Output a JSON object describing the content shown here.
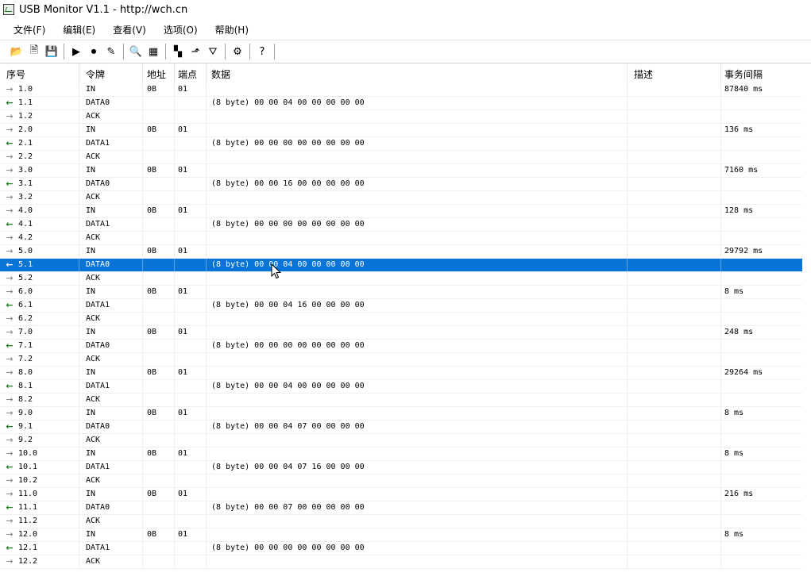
{
  "window": {
    "title": "USB Monitor V1.1 - http://wch.cn",
    "icon": "app-chart-icon"
  },
  "menu": [
    "文件(F)",
    "编辑(E)",
    "查看(V)",
    "选项(O)",
    "帮助(H)"
  ],
  "toolbar": [
    {
      "icon": "open-folder-icon",
      "glyph": "📂"
    },
    {
      "icon": "save-as-icon",
      "glyph": "🗎"
    },
    {
      "icon": "save-icon",
      "glyph": "💾"
    },
    {
      "sep": true
    },
    {
      "icon": "play-icon",
      "glyph": "▶"
    },
    {
      "icon": "record-icon",
      "glyph": "⏺"
    },
    {
      "icon": "edit-check-icon",
      "glyph": "✎"
    },
    {
      "sep": true
    },
    {
      "icon": "find-icon",
      "glyph": "🔍"
    },
    {
      "icon": "table-icon",
      "glyph": "▦"
    },
    {
      "sep": true
    },
    {
      "icon": "color-grid-icon",
      "glyph": "▚"
    },
    {
      "icon": "up-arrow-icon",
      "glyph": "⬏"
    },
    {
      "icon": "filter-icon",
      "glyph": "⛛"
    },
    {
      "sep": true
    },
    {
      "icon": "settings-icon",
      "glyph": "⚙"
    },
    {
      "sep": true
    },
    {
      "icon": "help-icon",
      "glyph": "?"
    },
    {
      "sep": true
    }
  ],
  "columns": {
    "seq": "序号",
    "token": "令牌",
    "addr": "地址",
    "ep": "端点",
    "data": "数据",
    "desc": "描述",
    "interval": "事务间隔"
  },
  "rows": [
    {
      "dir": "out",
      "seq": "1.0",
      "token": "IN",
      "addr": "0B",
      "ep": "01",
      "data": "",
      "desc": "",
      "interval": "87840 ms"
    },
    {
      "dir": "in",
      "seq": "1.1",
      "token": "DATA0",
      "addr": "",
      "ep": "",
      "data": "(8 byte) 00 00 04 00 00 00 00 00",
      "desc": "",
      "interval": ""
    },
    {
      "dir": "out",
      "seq": "1.2",
      "token": "ACK",
      "addr": "",
      "ep": "",
      "data": "",
      "desc": "",
      "interval": ""
    },
    {
      "dir": "out",
      "seq": "2.0",
      "token": "IN",
      "addr": "0B",
      "ep": "01",
      "data": "",
      "desc": "",
      "interval": "136 ms"
    },
    {
      "dir": "in",
      "seq": "2.1",
      "token": "DATA1",
      "addr": "",
      "ep": "",
      "data": "(8 byte) 00 00 00 00 00 00 00 00",
      "desc": "",
      "interval": ""
    },
    {
      "dir": "out",
      "seq": "2.2",
      "token": "ACK",
      "addr": "",
      "ep": "",
      "data": "",
      "desc": "",
      "interval": ""
    },
    {
      "dir": "out",
      "seq": "3.0",
      "token": "IN",
      "addr": "0B",
      "ep": "01",
      "data": "",
      "desc": "",
      "interval": "7160 ms"
    },
    {
      "dir": "in",
      "seq": "3.1",
      "token": "DATA0",
      "addr": "",
      "ep": "",
      "data": "(8 byte) 00 00 16 00 00 00 00 00",
      "desc": "",
      "interval": ""
    },
    {
      "dir": "out",
      "seq": "3.2",
      "token": "ACK",
      "addr": "",
      "ep": "",
      "data": "",
      "desc": "",
      "interval": ""
    },
    {
      "dir": "out",
      "seq": "4.0",
      "token": "IN",
      "addr": "0B",
      "ep": "01",
      "data": "",
      "desc": "",
      "interval": "128 ms"
    },
    {
      "dir": "in",
      "seq": "4.1",
      "token": "DATA1",
      "addr": "",
      "ep": "",
      "data": "(8 byte) 00 00 00 00 00 00 00 00",
      "desc": "",
      "interval": ""
    },
    {
      "dir": "out",
      "seq": "4.2",
      "token": "ACK",
      "addr": "",
      "ep": "",
      "data": "",
      "desc": "",
      "interval": ""
    },
    {
      "dir": "out",
      "seq": "5.0",
      "token": "IN",
      "addr": "0B",
      "ep": "01",
      "data": "",
      "desc": "",
      "interval": "29792 ms"
    },
    {
      "dir": "in",
      "seq": "5.1",
      "token": "DATA0",
      "addr": "",
      "ep": "",
      "data": "(8 byte) 00 00 04 00 00 00 00 00",
      "desc": "",
      "interval": "",
      "selected": true
    },
    {
      "dir": "out",
      "seq": "5.2",
      "token": "ACK",
      "addr": "",
      "ep": "",
      "data": "",
      "desc": "",
      "interval": ""
    },
    {
      "dir": "out",
      "seq": "6.0",
      "token": "IN",
      "addr": "0B",
      "ep": "01",
      "data": "",
      "desc": "",
      "interval": "8 ms"
    },
    {
      "dir": "in",
      "seq": "6.1",
      "token": "DATA1",
      "addr": "",
      "ep": "",
      "data": "(8 byte) 00 00 04 16 00 00 00 00",
      "desc": "",
      "interval": ""
    },
    {
      "dir": "out",
      "seq": "6.2",
      "token": "ACK",
      "addr": "",
      "ep": "",
      "data": "",
      "desc": "",
      "interval": ""
    },
    {
      "dir": "out",
      "seq": "7.0",
      "token": "IN",
      "addr": "0B",
      "ep": "01",
      "data": "",
      "desc": "",
      "interval": "248 ms"
    },
    {
      "dir": "in",
      "seq": "7.1",
      "token": "DATA0",
      "addr": "",
      "ep": "",
      "data": "(8 byte) 00 00 00 00 00 00 00 00",
      "desc": "",
      "interval": ""
    },
    {
      "dir": "out",
      "seq": "7.2",
      "token": "ACK",
      "addr": "",
      "ep": "",
      "data": "",
      "desc": "",
      "interval": ""
    },
    {
      "dir": "out",
      "seq": "8.0",
      "token": "IN",
      "addr": "0B",
      "ep": "01",
      "data": "",
      "desc": "",
      "interval": "29264 ms"
    },
    {
      "dir": "in",
      "seq": "8.1",
      "token": "DATA1",
      "addr": "",
      "ep": "",
      "data": "(8 byte) 00 00 04 00 00 00 00 00",
      "desc": "",
      "interval": ""
    },
    {
      "dir": "out",
      "seq": "8.2",
      "token": "ACK",
      "addr": "",
      "ep": "",
      "data": "",
      "desc": "",
      "interval": ""
    },
    {
      "dir": "out",
      "seq": "9.0",
      "token": "IN",
      "addr": "0B",
      "ep": "01",
      "data": "",
      "desc": "",
      "interval": "8 ms"
    },
    {
      "dir": "in",
      "seq": "9.1",
      "token": "DATA0",
      "addr": "",
      "ep": "",
      "data": "(8 byte) 00 00 04 07 00 00 00 00",
      "desc": "",
      "interval": ""
    },
    {
      "dir": "out",
      "seq": "9.2",
      "token": "ACK",
      "addr": "",
      "ep": "",
      "data": "",
      "desc": "",
      "interval": ""
    },
    {
      "dir": "out",
      "seq": "10.0",
      "token": "IN",
      "addr": "0B",
      "ep": "01",
      "data": "",
      "desc": "",
      "interval": "8 ms"
    },
    {
      "dir": "in",
      "seq": "10.1",
      "token": "DATA1",
      "addr": "",
      "ep": "",
      "data": "(8 byte) 00 00 04 07 16 00 00 00",
      "desc": "",
      "interval": ""
    },
    {
      "dir": "out",
      "seq": "10.2",
      "token": "ACK",
      "addr": "",
      "ep": "",
      "data": "",
      "desc": "",
      "interval": ""
    },
    {
      "dir": "out",
      "seq": "11.0",
      "token": "IN",
      "addr": "0B",
      "ep": "01",
      "data": "",
      "desc": "",
      "interval": "216 ms"
    },
    {
      "dir": "in",
      "seq": "11.1",
      "token": "DATA0",
      "addr": "",
      "ep": "",
      "data": "(8 byte) 00 00 07 00 00 00 00 00",
      "desc": "",
      "interval": ""
    },
    {
      "dir": "out",
      "seq": "11.2",
      "token": "ACK",
      "addr": "",
      "ep": "",
      "data": "",
      "desc": "",
      "interval": ""
    },
    {
      "dir": "out",
      "seq": "12.0",
      "token": "IN",
      "addr": "0B",
      "ep": "01",
      "data": "",
      "desc": "",
      "interval": "8 ms"
    },
    {
      "dir": "in",
      "seq": "12.1",
      "token": "DATA1",
      "addr": "",
      "ep": "",
      "data": "(8 byte) 00 00 00 00 00 00 00 00",
      "desc": "",
      "interval": ""
    },
    {
      "dir": "out",
      "seq": "12.2",
      "token": "ACK",
      "addr": "",
      "ep": "",
      "data": "",
      "desc": "",
      "interval": ""
    }
  ],
  "colors": {
    "selection": "#0a74d6",
    "in_arrow": "#1b7a1b",
    "out_arrow": "#7a7a7a"
  }
}
